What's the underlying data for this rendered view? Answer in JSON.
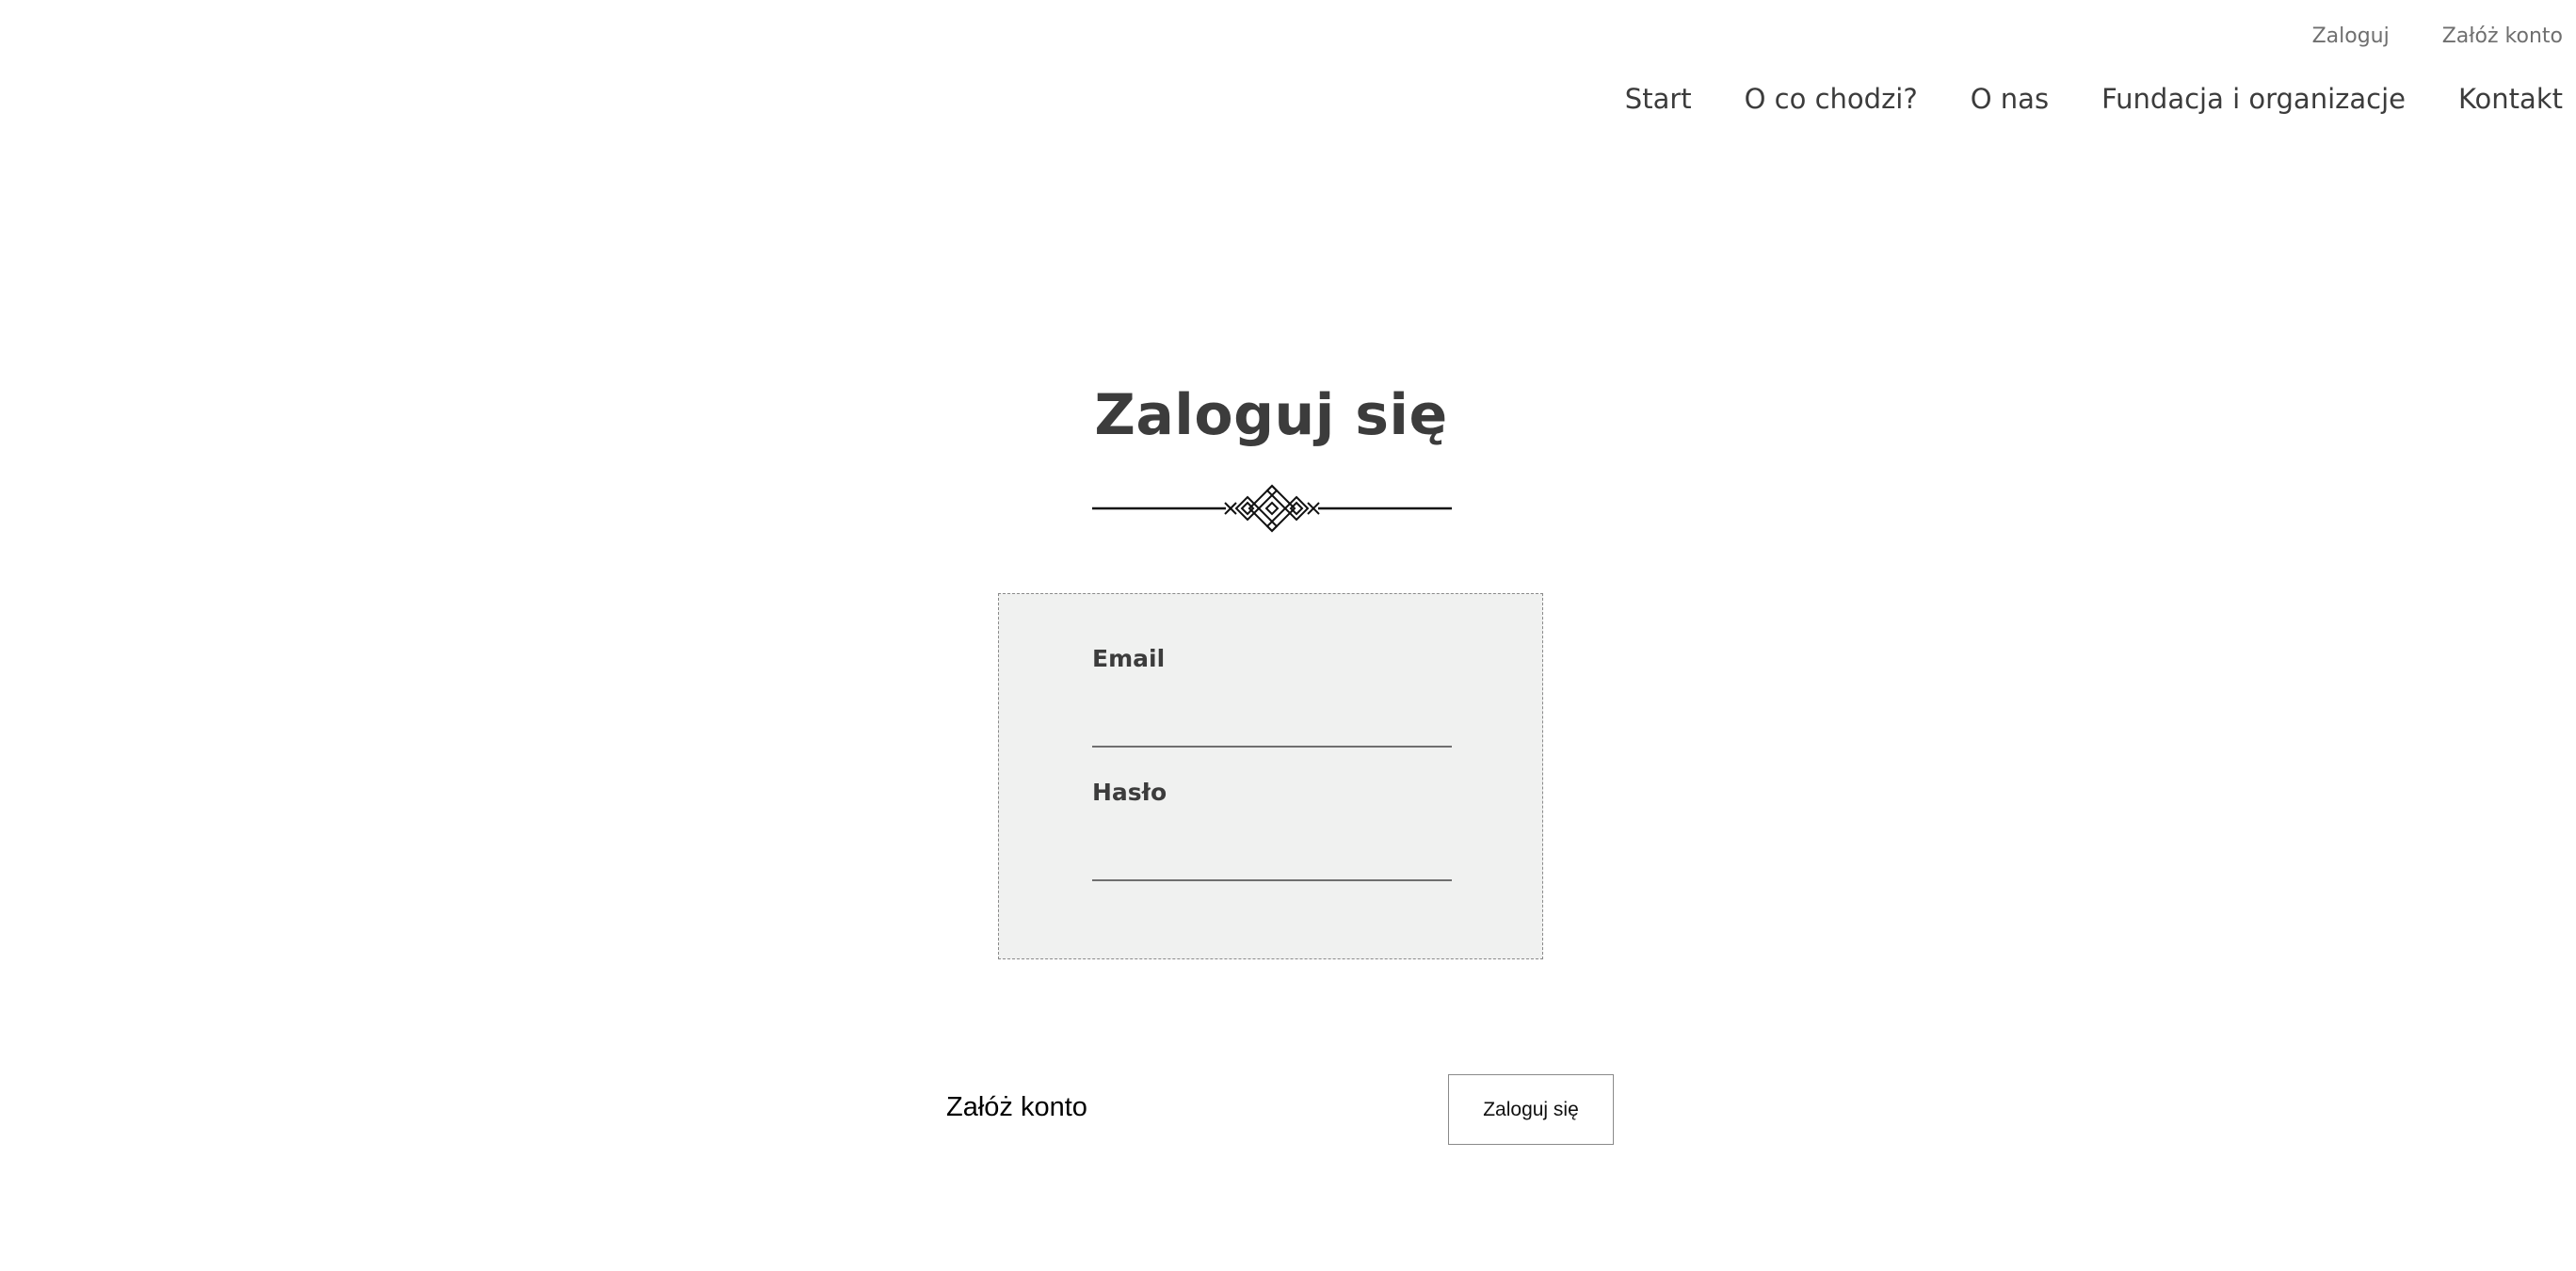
{
  "header": {
    "top_links": {
      "login": "Zaloguj",
      "register": "Załóż konto"
    },
    "nav": {
      "start": "Start",
      "about_what": "O co chodzi?",
      "about_us": "O nas",
      "foundation": "Fundacja i organizacje",
      "contact": "Kontakt"
    }
  },
  "page": {
    "title": "Zaloguj się"
  },
  "form": {
    "email_label": "Email",
    "email_value": "",
    "password_label": "Hasło",
    "password_value": ""
  },
  "actions": {
    "register_label": "Załóż konto",
    "submit_label": "Zaloguj się"
  },
  "icons": {
    "ornament": "decorative-divider-icon"
  }
}
